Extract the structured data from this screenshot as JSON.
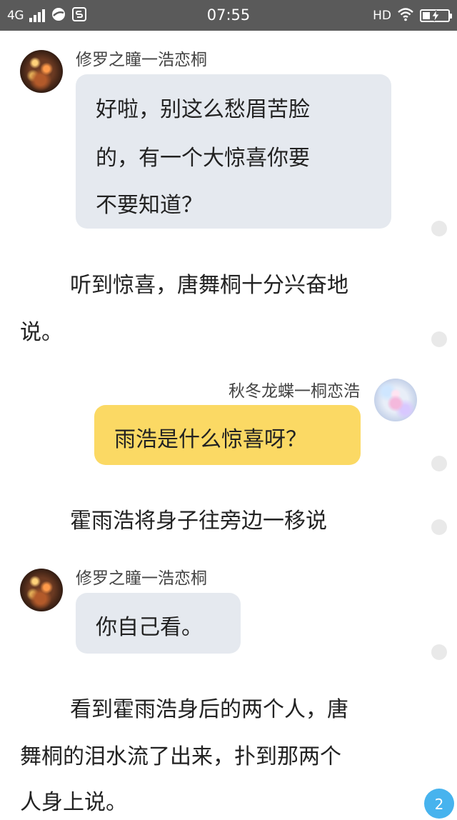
{
  "status_bar": {
    "network": "4G",
    "time": "07:55",
    "hd": "HD",
    "battery_level": 0.3
  },
  "messages": [
    {
      "type": "incoming",
      "sender": "修罗之瞳一浩恋桐",
      "lines": [
        "好啦，别这么愁眉苦脸",
        "的，有一个大惊喜你要",
        "不要知道？"
      ]
    },
    {
      "type": "narration",
      "lines": [
        "听到惊喜，唐舞桐十分兴奋地",
        "说。"
      ]
    },
    {
      "type": "outgoing",
      "sender": "秋冬龙蝶一桐恋浩",
      "lines": [
        "雨浩是什么惊喜呀？"
      ]
    },
    {
      "type": "narration",
      "lines": [
        "霍雨浩将身子往旁边一移说"
      ]
    },
    {
      "type": "incoming",
      "sender": "修罗之瞳一浩恋桐",
      "lines": [
        "你自己看。"
      ]
    },
    {
      "type": "narration",
      "lines": [
        "看到霍雨浩身后的两个人，唐",
        "舞桐的泪水流了出来，扑到那两个",
        "人身上说。"
      ]
    }
  ],
  "page_badge": "2"
}
